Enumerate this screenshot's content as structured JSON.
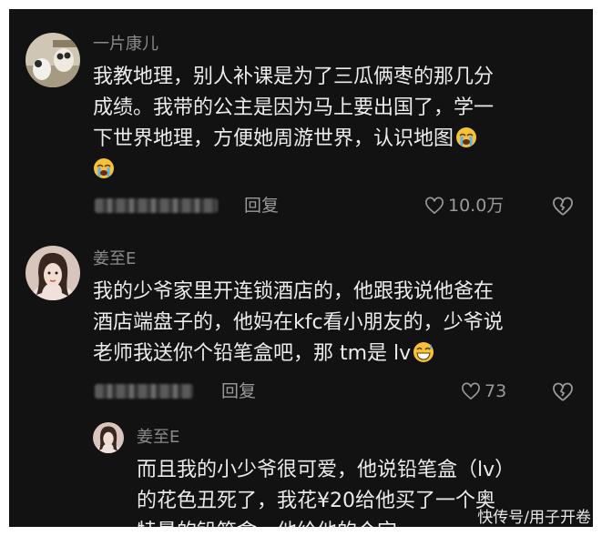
{
  "comments": [
    {
      "author": "一片康儿",
      "lines": [
        "我教地理，别人补课是为了三瓜俩枣的那几分",
        "成绩。我带的公主是因为马上要出国了，学一",
        "下世界地理，方便她周游世界，认识地图"
      ],
      "emoji": "loudly-crying-face",
      "reply_label": "回复",
      "likes": "10.0万"
    },
    {
      "author": "姜至E",
      "lines": [
        "我的少爷家里开连锁酒店的，他跟我说他爸在",
        "酒店端盘子的，他妈在kfc看小朋友的，少爷说",
        "老师我送你个铅笔盒吧，那 tm是 lv"
      ],
      "emoji": "grinning-sweat-face",
      "reply_label": "回复",
      "likes": "73"
    },
    {
      "author": "姜至E",
      "lines": [
        "而且我的小少爷很可爱，他说铅笔盒（lv）",
        "的花色丑死了，我花¥20给他买了一个奥",
        "特曼的铅笔盒，他给他的个宝"
      ]
    }
  ],
  "watermark": "快传号/用子开卷",
  "icons": {
    "like": "heart-outline-icon",
    "dislike": "broken-heart-icon"
  },
  "colors": {
    "background": "#121212",
    "text": "#ececec",
    "secondary": "#8a8a8a"
  }
}
